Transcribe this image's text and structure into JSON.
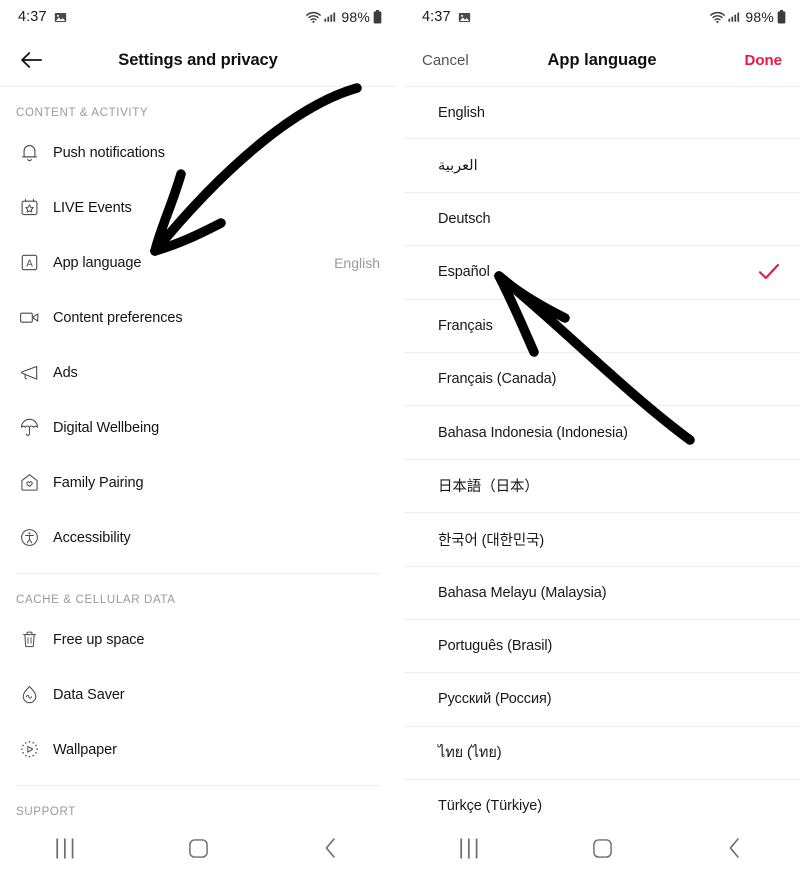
{
  "status_bar": {
    "time": "4:37",
    "battery_percent": "98%",
    "icons": [
      "screenshot-icon",
      "wifi-icon",
      "signal-icon",
      "battery-icon"
    ]
  },
  "colors": {
    "accent_pink": "#E8174B",
    "text_primary": "#141414",
    "text_secondary": "#9a9a9e",
    "divider": "#eeeeee",
    "annotation": "#000000"
  },
  "left_panel": {
    "header": {
      "back_icon": "arrow-left-icon",
      "title": "Settings and privacy"
    },
    "sections": [
      {
        "label": "CONTENT & ACTIVITY",
        "items": [
          {
            "icon": "bell-icon",
            "label": "Push notifications",
            "value": ""
          },
          {
            "icon": "calendar-star-icon",
            "label": "LIVE Events",
            "value": ""
          },
          {
            "icon": "letter-a-box-icon",
            "label": "App language",
            "value": "English"
          },
          {
            "icon": "video-camera-icon",
            "label": "Content preferences",
            "value": ""
          },
          {
            "icon": "megaphone-icon",
            "label": "Ads",
            "value": ""
          },
          {
            "icon": "umbrella-icon",
            "label": "Digital Wellbeing",
            "value": ""
          },
          {
            "icon": "house-heart-icon",
            "label": "Family Pairing",
            "value": ""
          },
          {
            "icon": "accessibility-icon",
            "label": "Accessibility",
            "value": ""
          }
        ]
      },
      {
        "label": "CACHE & CELLULAR DATA",
        "items": [
          {
            "icon": "trash-icon",
            "label": "Free up space",
            "value": ""
          },
          {
            "icon": "data-saver-icon",
            "label": "Data Saver",
            "value": ""
          },
          {
            "icon": "wallpaper-icon",
            "label": "Wallpaper",
            "value": ""
          }
        ]
      },
      {
        "label": "SUPPORT",
        "items": []
      }
    ]
  },
  "right_panel": {
    "header": {
      "cancel_label": "Cancel",
      "title": "App language",
      "done_label": "Done"
    },
    "selected_language": "Español",
    "languages": [
      {
        "name": "English",
        "selected": false
      },
      {
        "name": "العربية",
        "selected": false,
        "rtl": true
      },
      {
        "name": "Deutsch",
        "selected": false
      },
      {
        "name": "Español",
        "selected": true
      },
      {
        "name": "Français",
        "selected": false
      },
      {
        "name": "Français (Canada)",
        "selected": false
      },
      {
        "name": "Bahasa Indonesia (Indonesia)",
        "selected": false
      },
      {
        "name": "日本語（日本）",
        "selected": false
      },
      {
        "name": "한국어 (대한민국)",
        "selected": false
      },
      {
        "name": "Bahasa Melayu (Malaysia)",
        "selected": false
      },
      {
        "name": "Português (Brasil)",
        "selected": false
      },
      {
        "name": "Русский (Россия)",
        "selected": false
      },
      {
        "name": "ไทย (ไทย)",
        "selected": false
      },
      {
        "name": "Türkçe (Türkiye)",
        "selected": false
      }
    ]
  },
  "nav_bar": {
    "recents_icon": "recents-icon",
    "home_icon": "home-icon",
    "back_icon": "back-chevron-icon"
  },
  "annotations": [
    {
      "name": "arrow-pointing-to-app-language",
      "target": "App language"
    },
    {
      "name": "arrow-pointing-to-espanol",
      "target": "Español"
    }
  ]
}
